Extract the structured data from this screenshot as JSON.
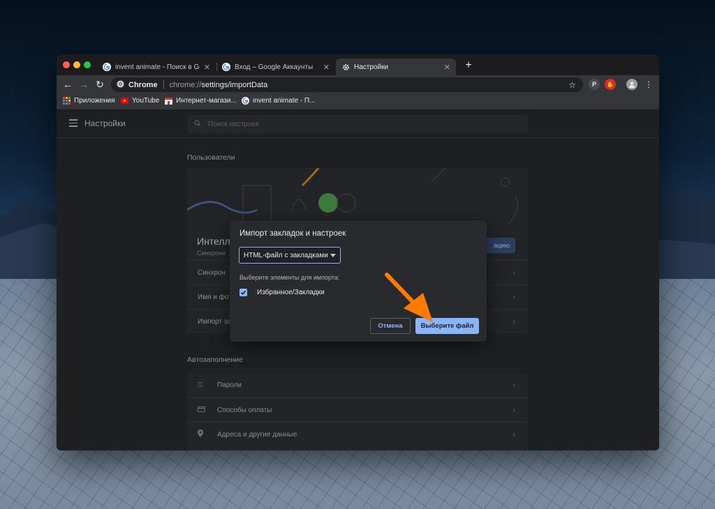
{
  "tabs": [
    {
      "label": "invent animate - Поиск в Goog",
      "close": "✕"
    },
    {
      "label": "Вход – Google Аккаунты",
      "close": "✕"
    },
    {
      "label": "Настройки",
      "close": "✕"
    }
  ],
  "new_tab": "+",
  "omnibox": {
    "chip_label": "Chrome",
    "url_host": "chrome://",
    "url_path": "settings/importData"
  },
  "bookmarks": [
    {
      "label": "Приложения"
    },
    {
      "label": "YouTube"
    },
    {
      "label": "Интернет-магази..."
    },
    {
      "label": "invent animate - П..."
    }
  ],
  "settings": {
    "title": "Настройки",
    "search_placeholder": "Поиск настроек",
    "people_section": "Пользователи",
    "profile_name": "Интелле",
    "profile_sub": "Синхрони",
    "sync_button": "ацию",
    "people_rows": [
      "Синхрон",
      "Имя и фот",
      "Импорт за"
    ],
    "autofill_section": "Автозаполнение",
    "autofill_rows": [
      "Пароли",
      "Способы оплаты",
      "Адреса и другие данные"
    ]
  },
  "dialog": {
    "title": "Импорт закладок и настроек",
    "select_value": "HTML-файл с закладками",
    "items_label": "Выберите элементы для импорта:",
    "checkbox_label": "Избранное/Закладки",
    "checkbox_checked": true,
    "cancel_label": "Отмена",
    "choose_label": "Выберите файл"
  },
  "colors": {
    "accent": "#8ab4f8",
    "arrow": "#ff7a00",
    "window_bg": "#202124",
    "toolbar_bg": "#35363a"
  },
  "icons": {
    "tab_1": "google-g-icon",
    "tab_2": "google-g-icon",
    "tab_3": "gear-icon",
    "bookmark_apps": "apps-grid-icon",
    "bookmark_youtube": "youtube-icon",
    "bookmark_store": "store-icon"
  }
}
